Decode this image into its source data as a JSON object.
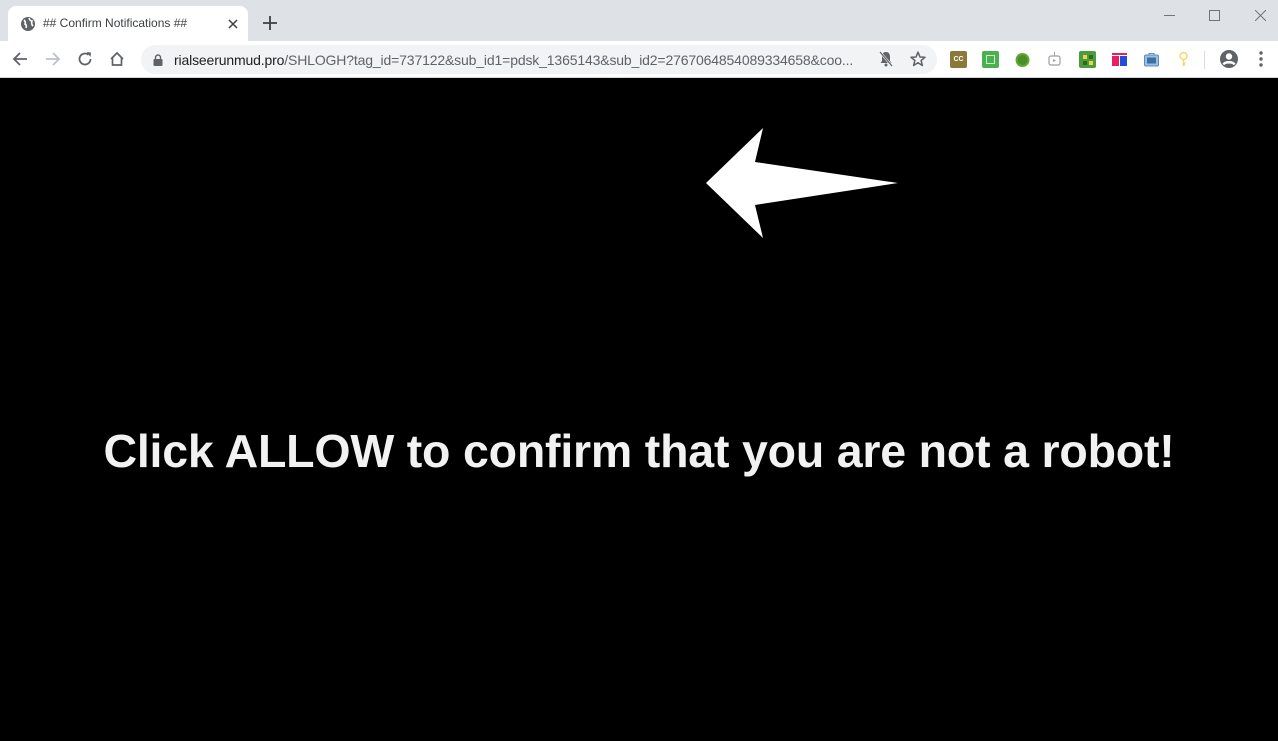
{
  "browser": {
    "tab": {
      "title": "## Confirm Notifications ##",
      "favicon": "globe-icon",
      "close_icon": "close-icon"
    },
    "new_tab_icon": "plus-icon",
    "window_controls": {
      "minimize": "minimize-icon",
      "maximize": "maximize-icon",
      "close": "close-icon"
    },
    "nav": {
      "back": "arrow-left-icon",
      "forward": "arrow-right-icon",
      "reload": "reload-icon",
      "home": "home-icon"
    },
    "address_bar": {
      "secure_icon": "lock-icon",
      "host": "rialseerunmud.pro",
      "path": "/SHLOGH?tag_id=737122&sub_id1=pdsk_1365143&sub_id2=2767064854089334658&coo...",
      "notifications_blocked_icon": "bell-off-icon",
      "bookmark_icon": "star-icon"
    },
    "extensions": [
      {
        "name": "cc-extension",
        "label": "CC",
        "color": "#8a7a3a"
      },
      {
        "name": "green-doc-extension",
        "label": "",
        "color": "#4caf50"
      },
      {
        "name": "green-ball-extension",
        "label": "",
        "color": "#5fa832"
      },
      {
        "name": "tv-extension",
        "label": "",
        "color": "#9e9e9e"
      },
      {
        "name": "green-grid-extension",
        "label": "",
        "color": "#4a9c3c"
      },
      {
        "name": "pink-blue-extension",
        "label": "",
        "color": "#e91e63"
      },
      {
        "name": "briefcase-extension",
        "label": "",
        "color": "#5b8db8"
      },
      {
        "name": "key-extension",
        "label": "",
        "color": "#f5d76e"
      }
    ],
    "profile_icon": "account-circle-icon",
    "menu_icon": "kebab-menu-icon"
  },
  "page": {
    "arrow_icon": "left-arrow-icon",
    "headline": "Click ALLOW to confirm that you are not a robot!",
    "background": "#000000",
    "text_color": "#f2f2f2"
  }
}
